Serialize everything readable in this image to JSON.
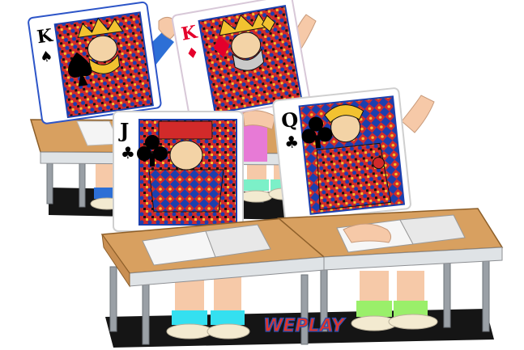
{
  "scene": {
    "description_free": true,
    "cards": [
      {
        "id": "king-spades",
        "rank": "K",
        "suit": "spade",
        "suit_glyph": "♠",
        "suit_color": "#000000"
      },
      {
        "id": "king-diamonds",
        "rank": "K",
        "suit": "diamond",
        "suit_glyph": "♦",
        "suit_color": "#e4002b"
      },
      {
        "id": "jack-clubs",
        "rank": "J",
        "suit": "club",
        "suit_glyph": "♣",
        "suit_color": "#000000"
      },
      {
        "id": "queen-clubs",
        "rank": "Q",
        "suit": "club",
        "suit_glyph": "♣",
        "suit_color": "#000000"
      }
    ],
    "logo": {
      "text": "WEPLAY",
      "color": "#e2342a",
      "stroke": "#2b4fb3"
    },
    "colors": {
      "desk_top": "#d8a060",
      "desk_edge": "#b07a3a",
      "desk_leg": "#9aa0a6",
      "floor_shadow": "#111111",
      "skin": "#f6c9a8",
      "sleeve_blue": "#2d6fd6",
      "sleeve_pink": "#e77ad6",
      "sock_cyan": "#34e0f0",
      "sock_green": "#9aef6a"
    }
  }
}
